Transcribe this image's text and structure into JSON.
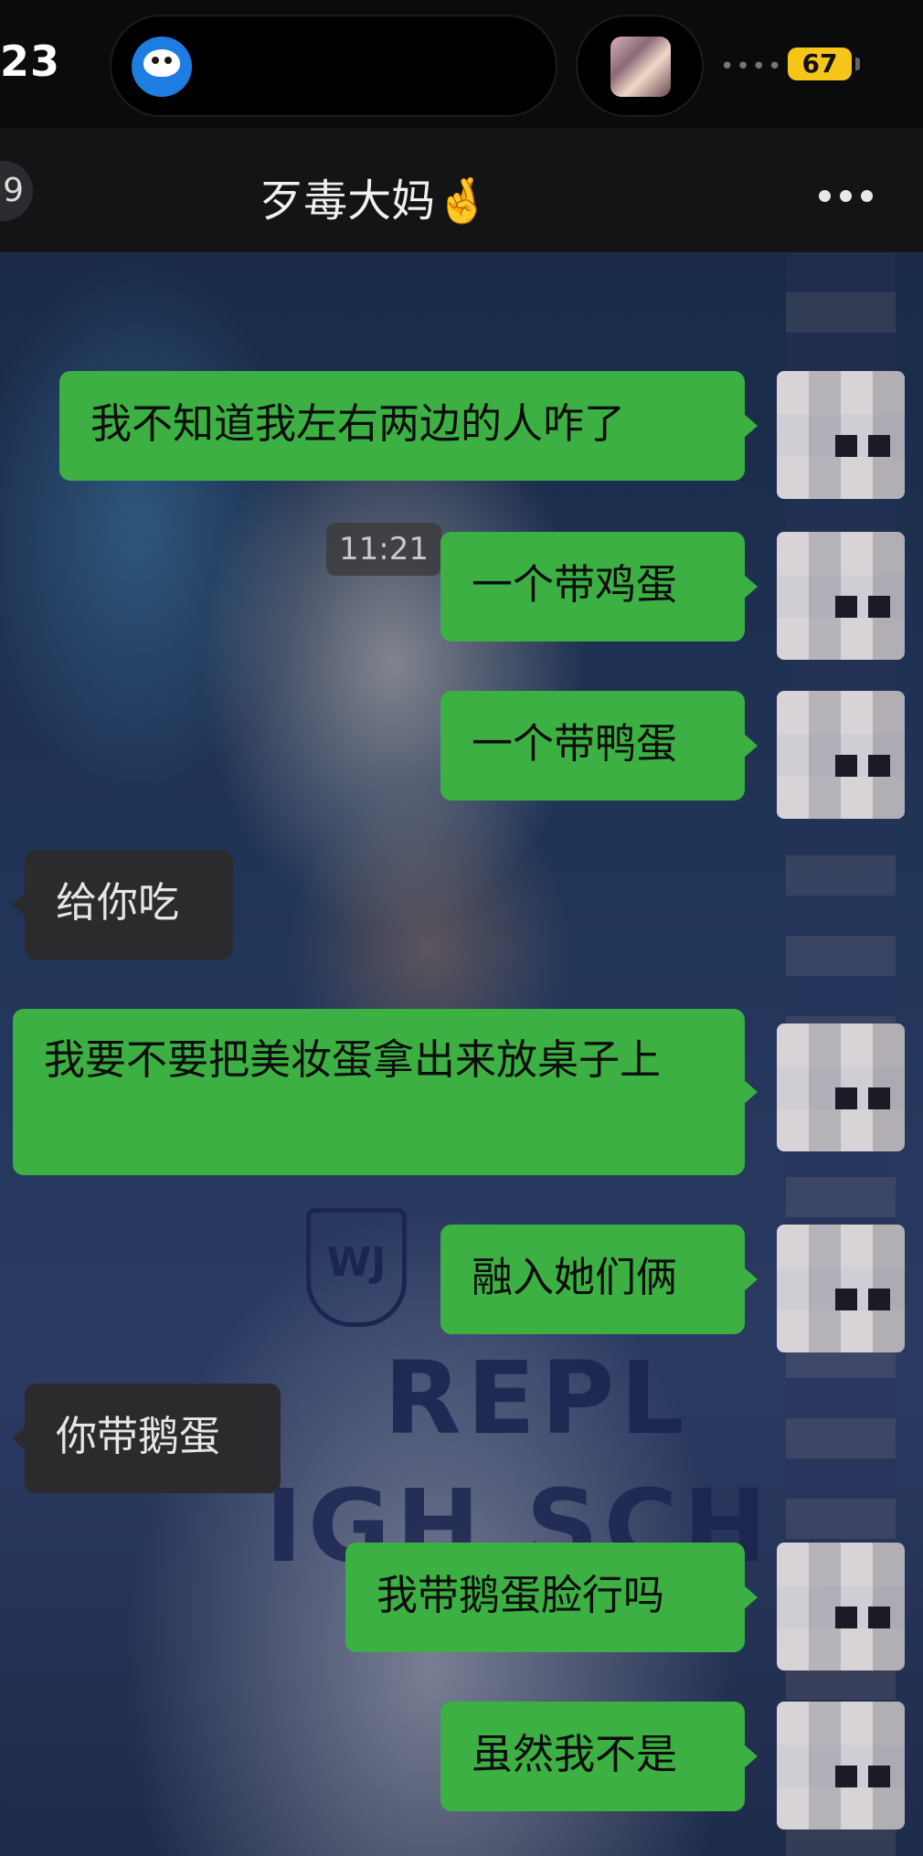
{
  "status_bar": {
    "time": "23",
    "battery": "67",
    "signal_dots": "••••"
  },
  "nav": {
    "back_badge": "9",
    "title": "歹毒大妈🤞"
  },
  "chat": {
    "timestamp": "11:21",
    "messages": [
      {
        "from": "me",
        "text": "我不知道我左右两边的人咋了"
      },
      {
        "from": "me",
        "text": "一个带鸡蛋"
      },
      {
        "from": "me",
        "text": "一个带鸭蛋"
      },
      {
        "from": "them",
        "text": "给你吃"
      },
      {
        "from": "me",
        "text": "我要不要把美妆蛋拿出来放桌子上"
      },
      {
        "from": "me",
        "text": "融入她们俩"
      },
      {
        "from": "them",
        "text": "你带鹅蛋"
      },
      {
        "from": "me",
        "text": "我带鹅蛋脸行吗"
      },
      {
        "from": "me",
        "text": "虽然我不是"
      }
    ]
  },
  "background": {
    "jersey_line1": "REPL",
    "jersey_line2": "IGH SCH",
    "crest_letters": "WJ"
  },
  "colors": {
    "my_bubble": "#3cb043",
    "their_bubble": "#2b2b2d",
    "battery": "#f5c518"
  }
}
